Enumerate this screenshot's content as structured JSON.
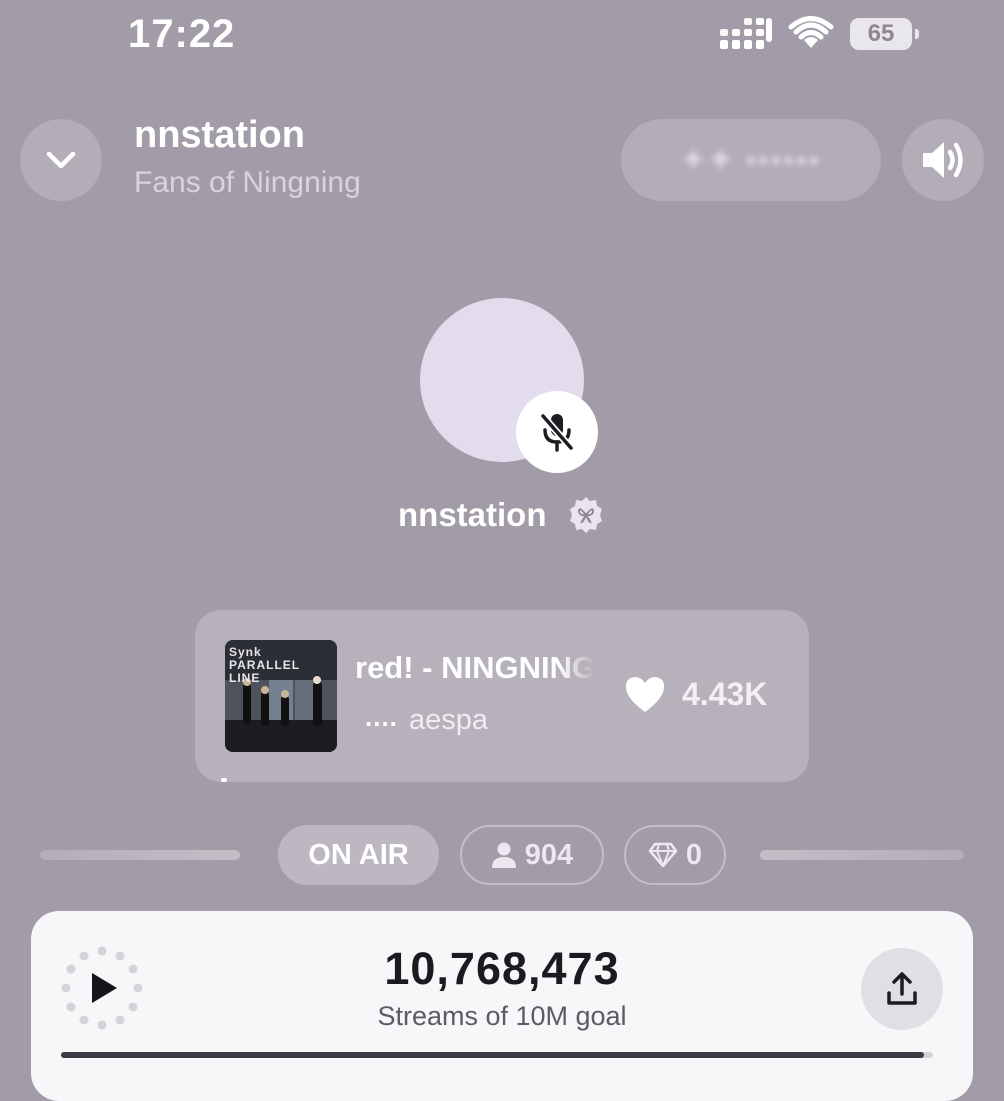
{
  "status_bar": {
    "time": "17:22",
    "battery": "65"
  },
  "header": {
    "title": "nnstation",
    "subtitle": "Fans of Ningning",
    "blurred_pill_text": "✦✦ ▪▪▪▪▪▪",
    "collapse_icon": "chevron-down-icon",
    "volume_icon": "speaker-icon"
  },
  "host": {
    "name": "nnstation",
    "mic_state": "muted"
  },
  "now_playing": {
    "title": "red! - NINGNING",
    "artist": "aespa",
    "dots": "....",
    "likes": "4.43K",
    "album_text": "Synk PARALLEL LINE"
  },
  "chips": {
    "on_air": "ON AIR",
    "listeners": "904",
    "gems": "0"
  },
  "player": {
    "streams": "10,768,473",
    "streams_label": "Streams of 10M goal",
    "goal_progress": 0.99
  },
  "colors": {
    "background": "#a29ca8",
    "player_bg": "#f7f6f8",
    "accent_dark": "#1e1c22"
  }
}
